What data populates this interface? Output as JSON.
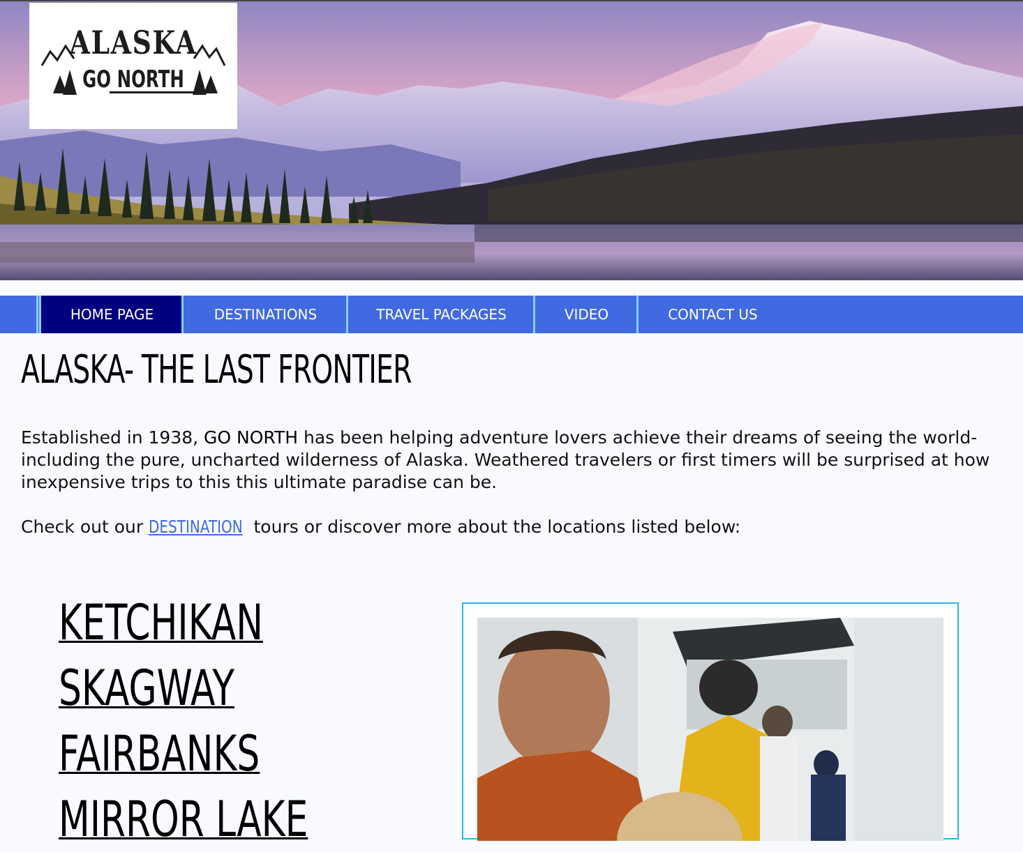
{
  "logo": {
    "line1": "ALASKA",
    "line2": "GO NORTH"
  },
  "nav": {
    "items": [
      {
        "label": "HOME PAGE",
        "active": true
      },
      {
        "label": "DESTINATIONS",
        "active": false
      },
      {
        "label": "TRAVEL PACKAGES",
        "active": false
      },
      {
        "label": "VIDEO",
        "active": false
      },
      {
        "label": "CONTACT US",
        "active": false
      }
    ]
  },
  "main": {
    "title": "ALASKA- THE LAST FRONTIER",
    "intro_before": "Established in 1938, ",
    "intro_brand": "GO NORTH",
    "intro_after": " has been helping adventure lovers achieve their dreams of seeing the world- including the pure, uncharted wilderness of Alaska. Weathered travelers or first timers will be surprised at how inexpensive trips to this this ultimate paradise can be.",
    "check_before": "Check out our ",
    "check_link": "DESTINATION",
    "check_after": " tours or discover more about the locations listed below:",
    "locations": [
      "KETCHIKAN",
      "SKAGWAY",
      "FAIRBANKS",
      "MIRROR LAKE"
    ]
  },
  "colors": {
    "nav_bg": "#4169e1",
    "nav_active": "#000080",
    "nav_divider": "#87cefa",
    "link": "#4169e1",
    "photo_border": "#29b6e6"
  },
  "icons": [
    "mountain-logo-icon",
    "pine-tree-icon"
  ]
}
